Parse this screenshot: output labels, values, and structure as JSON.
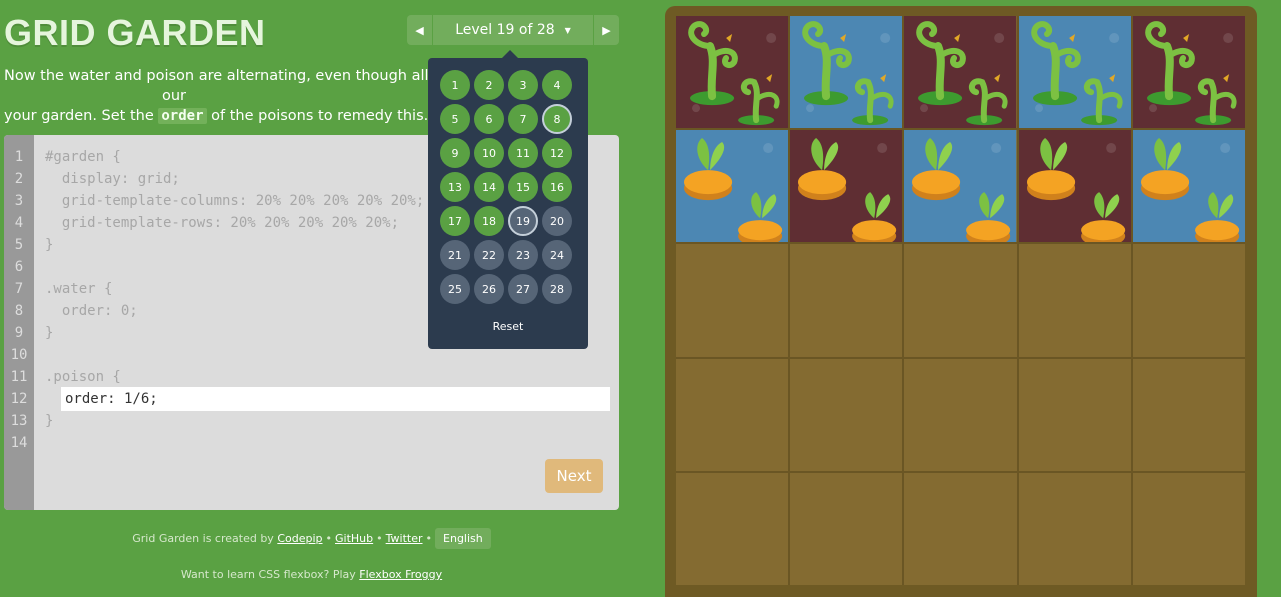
{
  "app": {
    "title": "GRID GARDEN"
  },
  "level_nav": {
    "label": "Level 19 of 28",
    "prev_icon": "triangle-left-icon",
    "next_icon": "triangle-right-icon"
  },
  "instructions": {
    "part1": "Now the water and poison are alternating, even though all of the w",
    "part2": "your garden. Set the ",
    "keyword": "order",
    "part3": " of the poisons to remedy this.",
    "tail": "our"
  },
  "editor": {
    "line_numbers": [
      "1",
      "2",
      "3",
      "4",
      "5",
      "6",
      "7",
      "8",
      "9",
      "10",
      "11",
      "12",
      "13",
      "14"
    ],
    "lines": [
      "#garden {",
      "  display: grid;",
      "  grid-template-columns: 20% 20% 20% 20% 20%;",
      "  grid-template-rows: 20% 20% 20% 20% 20%;",
      "}",
      "",
      ".water {",
      "  order: 0;",
      "}",
      "",
      ".poison {",
      "",
      "}",
      ""
    ],
    "input_value": "order: 1/6;",
    "next_label": "Next"
  },
  "dropdown": {
    "levels": [
      {
        "n": "1",
        "state": "solved"
      },
      {
        "n": "2",
        "state": "solved"
      },
      {
        "n": "3",
        "state": "solved"
      },
      {
        "n": "4",
        "state": "solved"
      },
      {
        "n": "5",
        "state": "solved"
      },
      {
        "n": "6",
        "state": "solved"
      },
      {
        "n": "7",
        "state": "solved"
      },
      {
        "n": "8",
        "state": "solved-current"
      },
      {
        "n": "9",
        "state": "solved"
      },
      {
        "n": "10",
        "state": "solved"
      },
      {
        "n": "11",
        "state": "solved"
      },
      {
        "n": "12",
        "state": "solved"
      },
      {
        "n": "13",
        "state": "solved"
      },
      {
        "n": "14",
        "state": "solved"
      },
      {
        "n": "15",
        "state": "solved"
      },
      {
        "n": "16",
        "state": "solved"
      },
      {
        "n": "17",
        "state": "solved"
      },
      {
        "n": "18",
        "state": "solved"
      },
      {
        "n": "19",
        "state": "current"
      },
      {
        "n": "20",
        "state": "todo"
      },
      {
        "n": "21",
        "state": "todo"
      },
      {
        "n": "22",
        "state": "todo"
      },
      {
        "n": "23",
        "state": "todo"
      },
      {
        "n": "24",
        "state": "todo"
      },
      {
        "n": "25",
        "state": "todo"
      },
      {
        "n": "26",
        "state": "todo"
      },
      {
        "n": "27",
        "state": "todo"
      },
      {
        "n": "28",
        "state": "todo"
      }
    ],
    "reset_label": "Reset"
  },
  "footer": {
    "created_by": "Grid Garden is created by",
    "codepip": "Codepip",
    "github": "GitHub",
    "twitter": "Twitter",
    "language": "English",
    "learn_text": "Want to learn CSS flexbox? Play",
    "froggy": "Flexbox Froggy"
  },
  "garden": {
    "rows": [
      [
        "poison-weed",
        "water-weed",
        "poison-weed",
        "water-weed",
        "poison-weed"
      ],
      [
        "water-carrot",
        "poison-carrot",
        "water-carrot",
        "poison-carrot",
        "water-carrot"
      ],
      [
        "dirt",
        "dirt",
        "dirt",
        "dirt",
        "dirt"
      ],
      [
        "dirt",
        "dirt",
        "dirt",
        "dirt",
        "dirt"
      ],
      [
        "dirt",
        "dirt",
        "dirt",
        "dirt",
        "dirt"
      ]
    ]
  },
  "colors": {
    "background": "#5aa143",
    "poison": "#5f2e33",
    "water": "#4c87b3",
    "dirt": "#846b31",
    "dropdown": "#2c3b4e",
    "next_button": "#e0b97b"
  }
}
